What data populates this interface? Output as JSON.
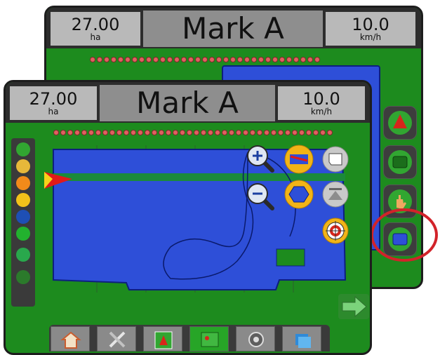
{
  "back_screen": {
    "area_value": "27.00",
    "area_unit": "ha",
    "title": "Mark A",
    "speed_value": "10.0",
    "speed_unit": "km/h",
    "right_buttons": [
      "guidance-icon",
      "field-view-icon",
      "pan-hand-icon",
      "map-view-icon"
    ]
  },
  "front_screen": {
    "area_value": "27.00",
    "area_unit": "ha",
    "title": "Mark A",
    "speed_value": "10.0",
    "speed_unit": "km/h",
    "map_tools": [
      "zoom-in-icon",
      "zoom-out-icon",
      "vehicle-view-icon",
      "map-coverage-icon",
      "field-boundary-icon",
      "perspective-icon",
      "target-icon"
    ],
    "left_status_icons": [
      "boundary-icon",
      "guideline-icon",
      "alert-icon",
      "gps-icon",
      "tilt-icon",
      "section-icon",
      "drop-icon",
      "boom-icon"
    ],
    "next_button_icon": "arrow-right-icon",
    "bottom_tabs": [
      {
        "name": "home",
        "icon": "home-icon",
        "active": false
      },
      {
        "name": "tools",
        "icon": "tools-icon",
        "active": false
      },
      {
        "name": "vehicle-view",
        "icon": "vehicle-view-icon",
        "active": false
      },
      {
        "name": "field-view",
        "icon": "field-view-icon",
        "active": true
      },
      {
        "name": "console",
        "icon": "console-icon",
        "active": false
      },
      {
        "name": "data",
        "icon": "data-icon",
        "active": false
      }
    ]
  },
  "colors": {
    "background_green": "#1d8b1e",
    "coverage_blue": "#2e4fd8",
    "highlight_ring": "#d2232a",
    "guideline": "#1b8a3a",
    "button_yellow": "#f2b417"
  }
}
